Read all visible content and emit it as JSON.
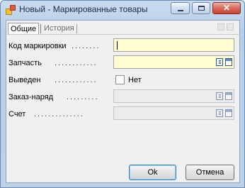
{
  "window": {
    "title": "Новый - Маркированные товары",
    "close_glyph": "✕"
  },
  "tabs": [
    {
      "label": "Общие"
    },
    {
      "label": "История"
    }
  ],
  "fields": {
    "code": {
      "label": "Код маркировки",
      "dots": "........",
      "value": ""
    },
    "part": {
      "label": "Запчасть",
      "dots": "............",
      "value": ""
    },
    "withdrawn": {
      "label": "Выведен",
      "dots": "............",
      "checked": false,
      "option_label": "Нет"
    },
    "order": {
      "label": "Заказ-наряд",
      "dots": ".........",
      "value": ""
    },
    "invoice": {
      "label": "Счет",
      "dots": "..............",
      "value": ""
    }
  },
  "buttons": {
    "ok": "Ok",
    "cancel": "Отмена"
  },
  "icons": {
    "app": "app-icon",
    "lookup": "book-list-icon",
    "open": "window-icon"
  }
}
